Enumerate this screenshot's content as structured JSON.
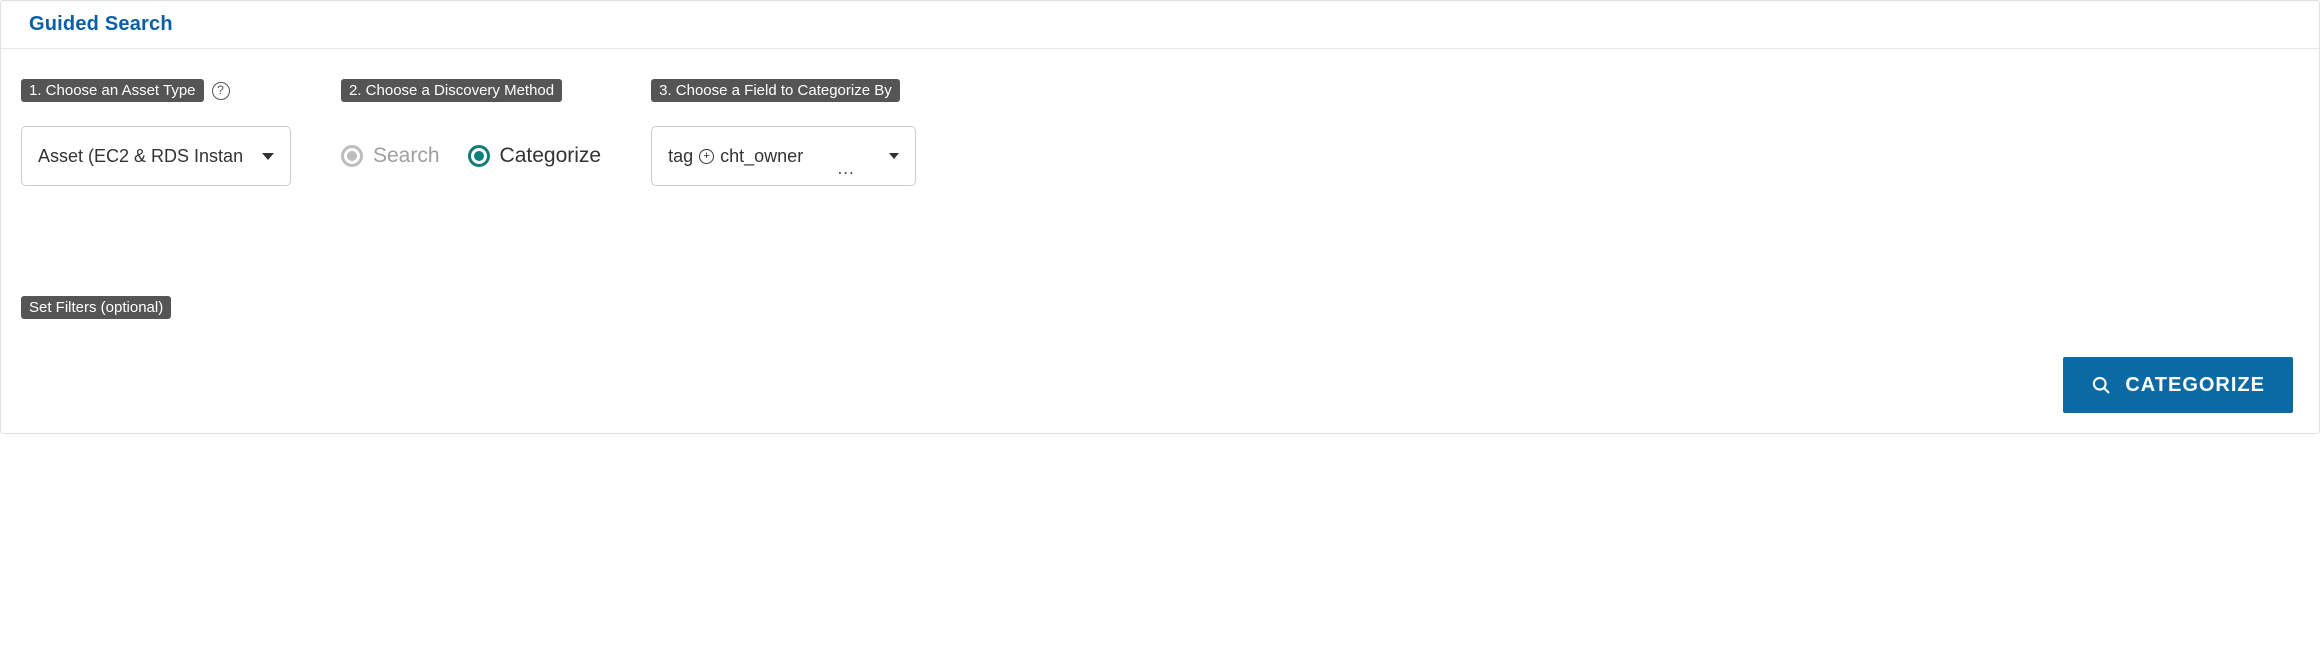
{
  "panel": {
    "title": "Guided Search"
  },
  "step1": {
    "label": "1. Choose an Asset Type",
    "selectValue": "Asset (EC2 & RDS Instan"
  },
  "step2": {
    "label": "2. Choose a Discovery Method",
    "options": {
      "search": "Search",
      "categorize": "Categorize"
    }
  },
  "step3": {
    "label": "3. Choose a Field to Categorize By",
    "field": {
      "prefix": "tag",
      "name": "cht_owner"
    }
  },
  "filters": {
    "label": "Set Filters (optional)"
  },
  "action": {
    "buttonLabel": "CATEGORIZE"
  }
}
